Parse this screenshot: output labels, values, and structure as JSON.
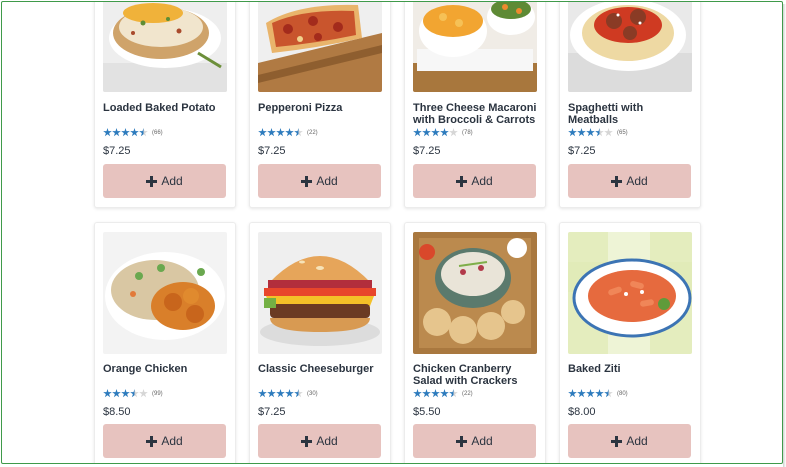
{
  "products": [
    {
      "name": "Loaded Baked Potato",
      "count": "(66)",
      "price": "$7.25",
      "rating": 4.5,
      "button": "Add",
      "image": "baked-potato-photo"
    },
    {
      "name": "Pepperoni Pizza",
      "count": "(22)",
      "price": "$7.25",
      "rating": 4.5,
      "button": "Add",
      "image": "pizza-photo"
    },
    {
      "name": "Three Cheese Macaroni with Broccoli & Carrots",
      "count": "(78)",
      "price": "$7.25",
      "rating": 4.0,
      "button": "Add",
      "image": "macaroni-photo"
    },
    {
      "name": "Spaghetti with Meatballs",
      "count": "(65)",
      "price": "$7.25",
      "rating": 3.5,
      "button": "Add",
      "image": "spaghetti-photo"
    },
    {
      "name": "Orange Chicken",
      "count": "(99)",
      "price": "$8.50",
      "rating": 3.5,
      "button": "Add",
      "image": "orange-chicken-photo"
    },
    {
      "name": "Classic Cheeseburger",
      "count": "(30)",
      "price": "$7.25",
      "rating": 4.5,
      "button": "Add",
      "image": "cheeseburger-photo"
    },
    {
      "name": "Chicken Cranberry Salad with Crackers",
      "count": "(22)",
      "price": "$5.50",
      "rating": 4.5,
      "button": "Add",
      "image": "chicken-salad-photo"
    },
    {
      "name": "Baked Ziti",
      "count": "(80)",
      "price": "$8.00",
      "rating": 4.5,
      "button": "Add",
      "image": "baked-ziti-photo"
    }
  ],
  "colors": {
    "button_bg": "#e7c3bf",
    "star_filled": "#2d7bbd",
    "star_empty": "#d6d6d6",
    "text": "#2b3440",
    "frame_border": "#3f9a4a"
  }
}
